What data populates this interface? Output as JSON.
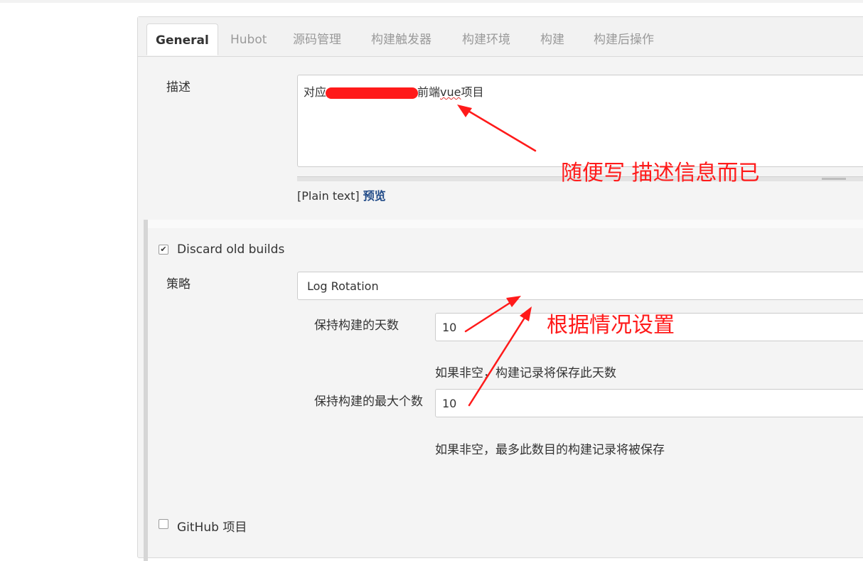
{
  "tabs": [
    {
      "label": "General"
    },
    {
      "label": "Hubot"
    },
    {
      "label": "源码管理"
    },
    {
      "label": "构建触发器"
    },
    {
      "label": "构建环境"
    },
    {
      "label": "构建"
    },
    {
      "label": "构建后操作"
    }
  ],
  "description": {
    "label": "描述",
    "value_prefix": "对应",
    "value_mid": "前端",
    "value_misspelled": "vue",
    "value_suffix": "项目",
    "plain_text": "[Plain text]",
    "preview": "预览"
  },
  "discard": {
    "checked": true,
    "label": "Discard old builds",
    "strategy_label": "策略",
    "strategy_value": "Log Rotation",
    "days_label": "保持构建的天数",
    "days_value": "10",
    "days_help": "如果非空，构建记录将保存此天数",
    "max_label": "保持构建的最大个数",
    "max_value": "10",
    "max_help": "如果非空，最多此数目的构建记录将被保存"
  },
  "github": {
    "checked": false,
    "label": "GitHub 项目"
  },
  "annotations": {
    "description_note": "随便写 描述信息而已",
    "settings_note": "根据情况设置",
    "color": "#ff1a1a"
  }
}
